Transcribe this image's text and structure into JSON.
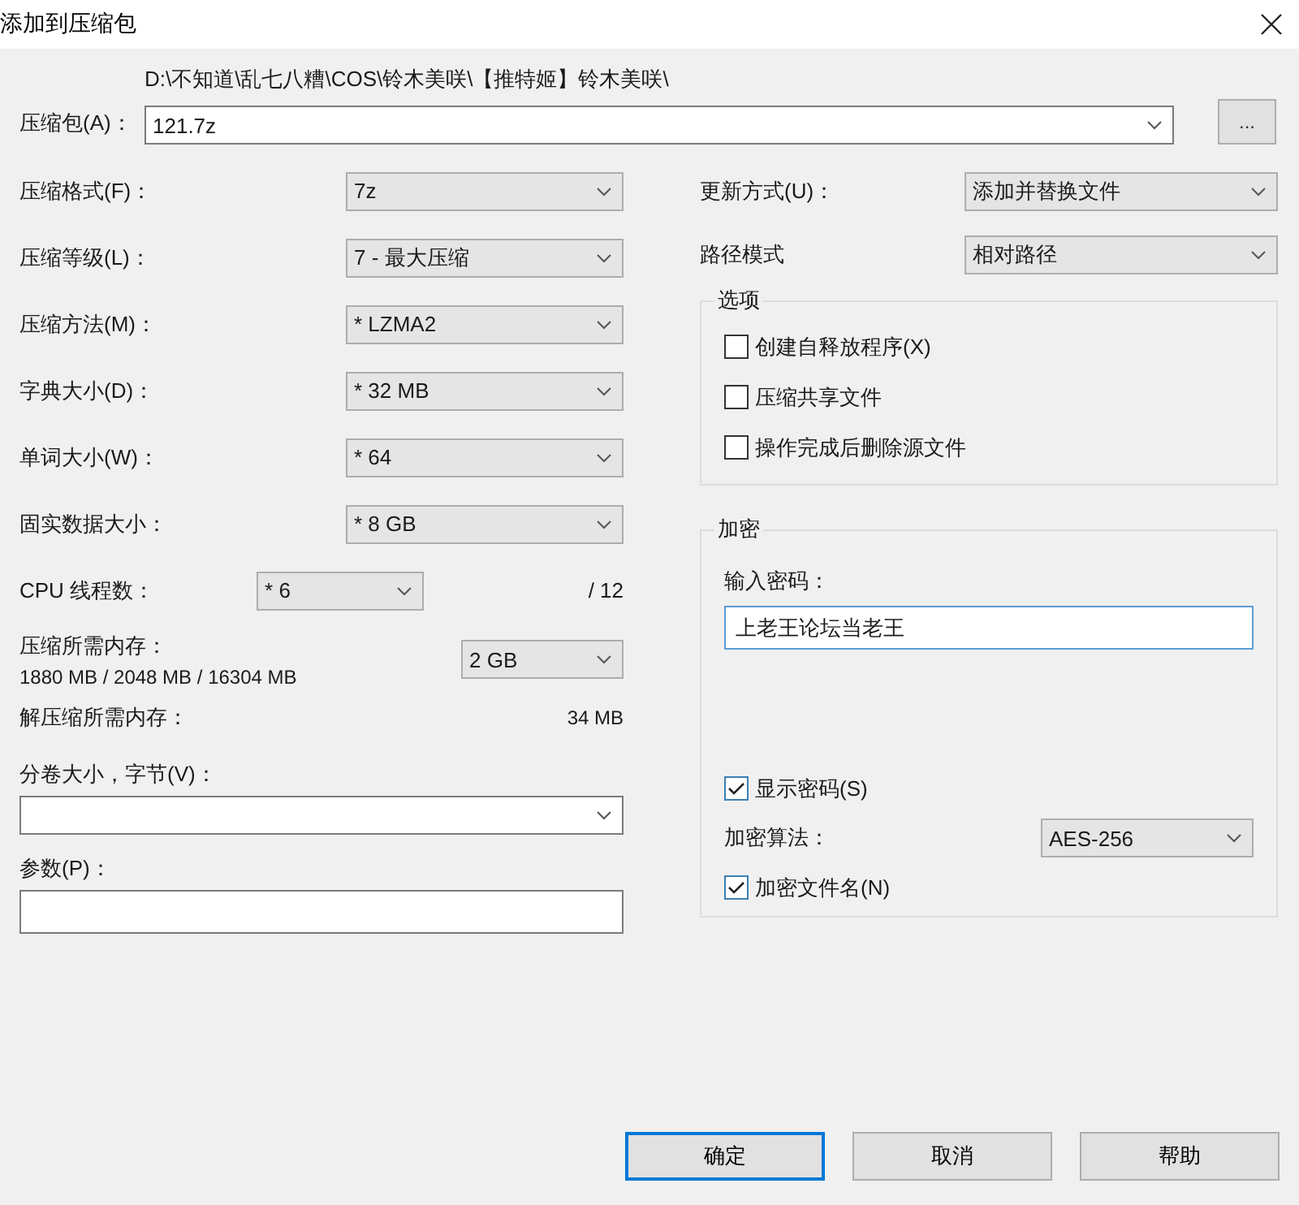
{
  "window": {
    "title": "添加到压缩包"
  },
  "archive": {
    "label": "压缩包(A)：",
    "path": "D:\\不知道\\乱七八糟\\COS\\铃木美咲\\【推特姬】铃木美咲\\",
    "value": "121.7z",
    "browse": "..."
  },
  "settings": [
    {
      "label": "压缩格式(F)：",
      "value": "7z"
    },
    {
      "label": "压缩等级(L)：",
      "value": "7 - 最大压缩"
    },
    {
      "label": "压缩方法(M)：",
      "value": "* LZMA2"
    },
    {
      "label": "字典大小(D)：",
      "value": "* 32 MB"
    },
    {
      "label": "单词大小(W)：",
      "value": "* 64"
    },
    {
      "label": "固实数据大小：",
      "value": "* 8 GB"
    }
  ],
  "threads": {
    "label": "CPU 线程数：",
    "value": "* 6",
    "total": "/ 12"
  },
  "memory": {
    "label": "压缩所需内存：",
    "detail": "1880 MB / 2048 MB / 16304 MB",
    "value": "2 GB"
  },
  "decompress_memory": {
    "label": "解压缩所需内存：",
    "value": "34 MB"
  },
  "volume": {
    "label": "分卷大小，字节(V)："
  },
  "parameters": {
    "label": "参数(P)："
  },
  "update": [
    {
      "label": "更新方式(U)：",
      "value": "添加并替换文件"
    },
    {
      "label": "路径模式",
      "value": "相对路径"
    }
  ],
  "options": {
    "title": "选项",
    "items": [
      {
        "label": "创建自释放程序(X)",
        "checked": false
      },
      {
        "label": "压缩共享文件",
        "checked": false
      },
      {
        "label": "操作完成后删除源文件",
        "checked": false
      }
    ]
  },
  "encryption": {
    "title": "加密",
    "password_label": "输入密码：",
    "password": "上老王论坛当老王",
    "show_password": {
      "label": "显示密码(S)",
      "checked": true
    },
    "method_label": "加密算法：",
    "method": "AES-256",
    "encrypt_names": {
      "label": "加密文件名(N)",
      "checked": true
    }
  },
  "buttons": [
    {
      "label": "确定",
      "default": true
    },
    {
      "label": "取消",
      "default": false
    },
    {
      "label": "帮助",
      "default": false
    }
  ]
}
